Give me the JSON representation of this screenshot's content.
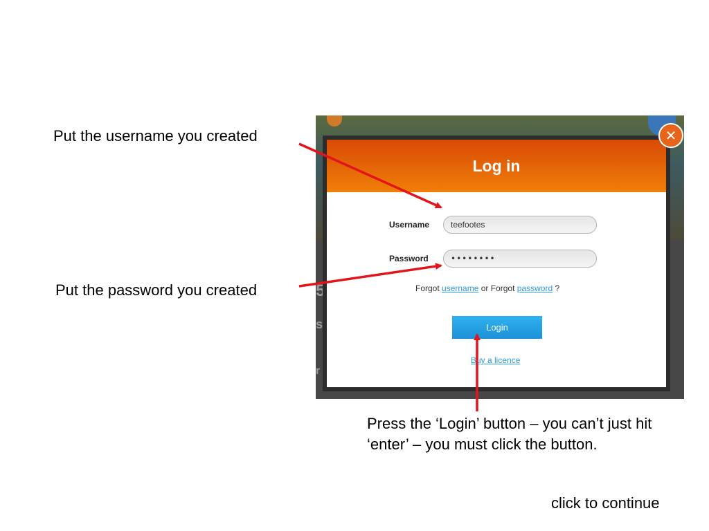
{
  "callouts": {
    "username": "Put the username you created",
    "password": "Put the password you created",
    "login": "Press the ‘Login’ button – you can’t just hit ‘enter’ – you must click the button.",
    "continue": "click to continue"
  },
  "dialog": {
    "title": "Log in",
    "close_icon": "close-x-icon",
    "username_label": "Username",
    "username_value": "teefootes",
    "password_label": "Password",
    "password_value": "••••••••",
    "forgot_prefix": "Forgot",
    "forgot_username_link": "username",
    "forgot_middle": "or Forgot",
    "forgot_password_link": "password",
    "forgot_suffix": "?",
    "login_button": "Login",
    "buy_licence_link": "Buy a licence"
  },
  "background_letters": [
    "5",
    "s",
    "r"
  ],
  "colors": {
    "header_orange": "#f07f08",
    "login_blue": "#1c91d9",
    "link_blue": "#2a9be0",
    "arrow_red": "#e3141b"
  }
}
